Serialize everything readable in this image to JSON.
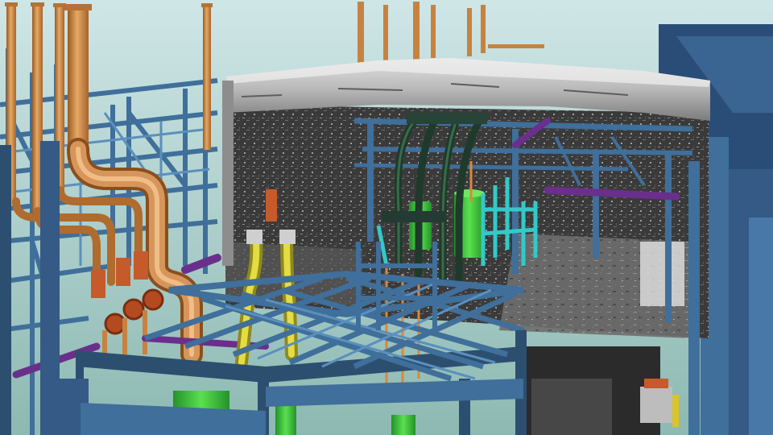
{
  "scene": {
    "subject": "",
    "palette": {
      "sky_top": "#c9e3e4",
      "sky_bottom": "#8fbdb6",
      "steel_blue": "#3f6f9a",
      "steel_dark": "#2c4f70",
      "steel_light": "#5b8fbd",
      "copper_pipe": "#c8823f",
      "copper_highlight": "#e6a865",
      "orange_rust": "#c75a2a",
      "yellow_pipe": "#c9c32a",
      "green_tank": "#3fcf3a",
      "green_dark": "#23922a",
      "cyan_pipe": "#33c9c9",
      "purple_pipe": "#6a2f8c",
      "concrete_scan": "#9a9a9a",
      "scan_dark": "#2e2e2e",
      "building_navy": "#2a4d78"
    }
  }
}
